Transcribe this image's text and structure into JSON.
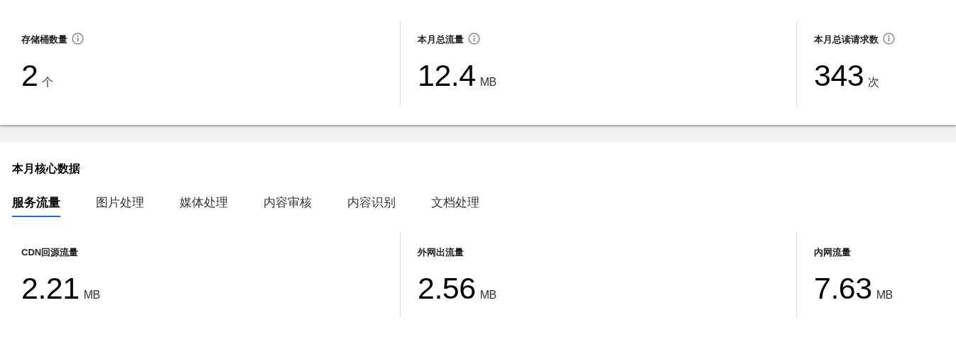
{
  "summary": [
    {
      "label": "存储桶数量",
      "info": true,
      "value": "2",
      "unit": "个"
    },
    {
      "label": "本月总流量",
      "info": true,
      "value": "12.4",
      "unit": "MB"
    },
    {
      "label": "本月总读请求数",
      "info": true,
      "value": "343",
      "unit": "次"
    }
  ],
  "core": {
    "title": "本月核心数据",
    "tabs": [
      {
        "label": "服务流量",
        "selected": true
      },
      {
        "label": "图片处理",
        "selected": false
      },
      {
        "label": "媒体处理",
        "selected": false
      },
      {
        "label": "内容审核",
        "selected": false
      },
      {
        "label": "内容识别",
        "selected": false
      },
      {
        "label": "文档处理",
        "selected": false
      }
    ],
    "stats": [
      {
        "label": "CDN回源流量",
        "value": "2.21",
        "unit": "MB"
      },
      {
        "label": "外网出流量",
        "value": "2.56",
        "unit": "MB"
      },
      {
        "label": "内网流量",
        "value": "7.63",
        "unit": "MB"
      }
    ]
  }
}
